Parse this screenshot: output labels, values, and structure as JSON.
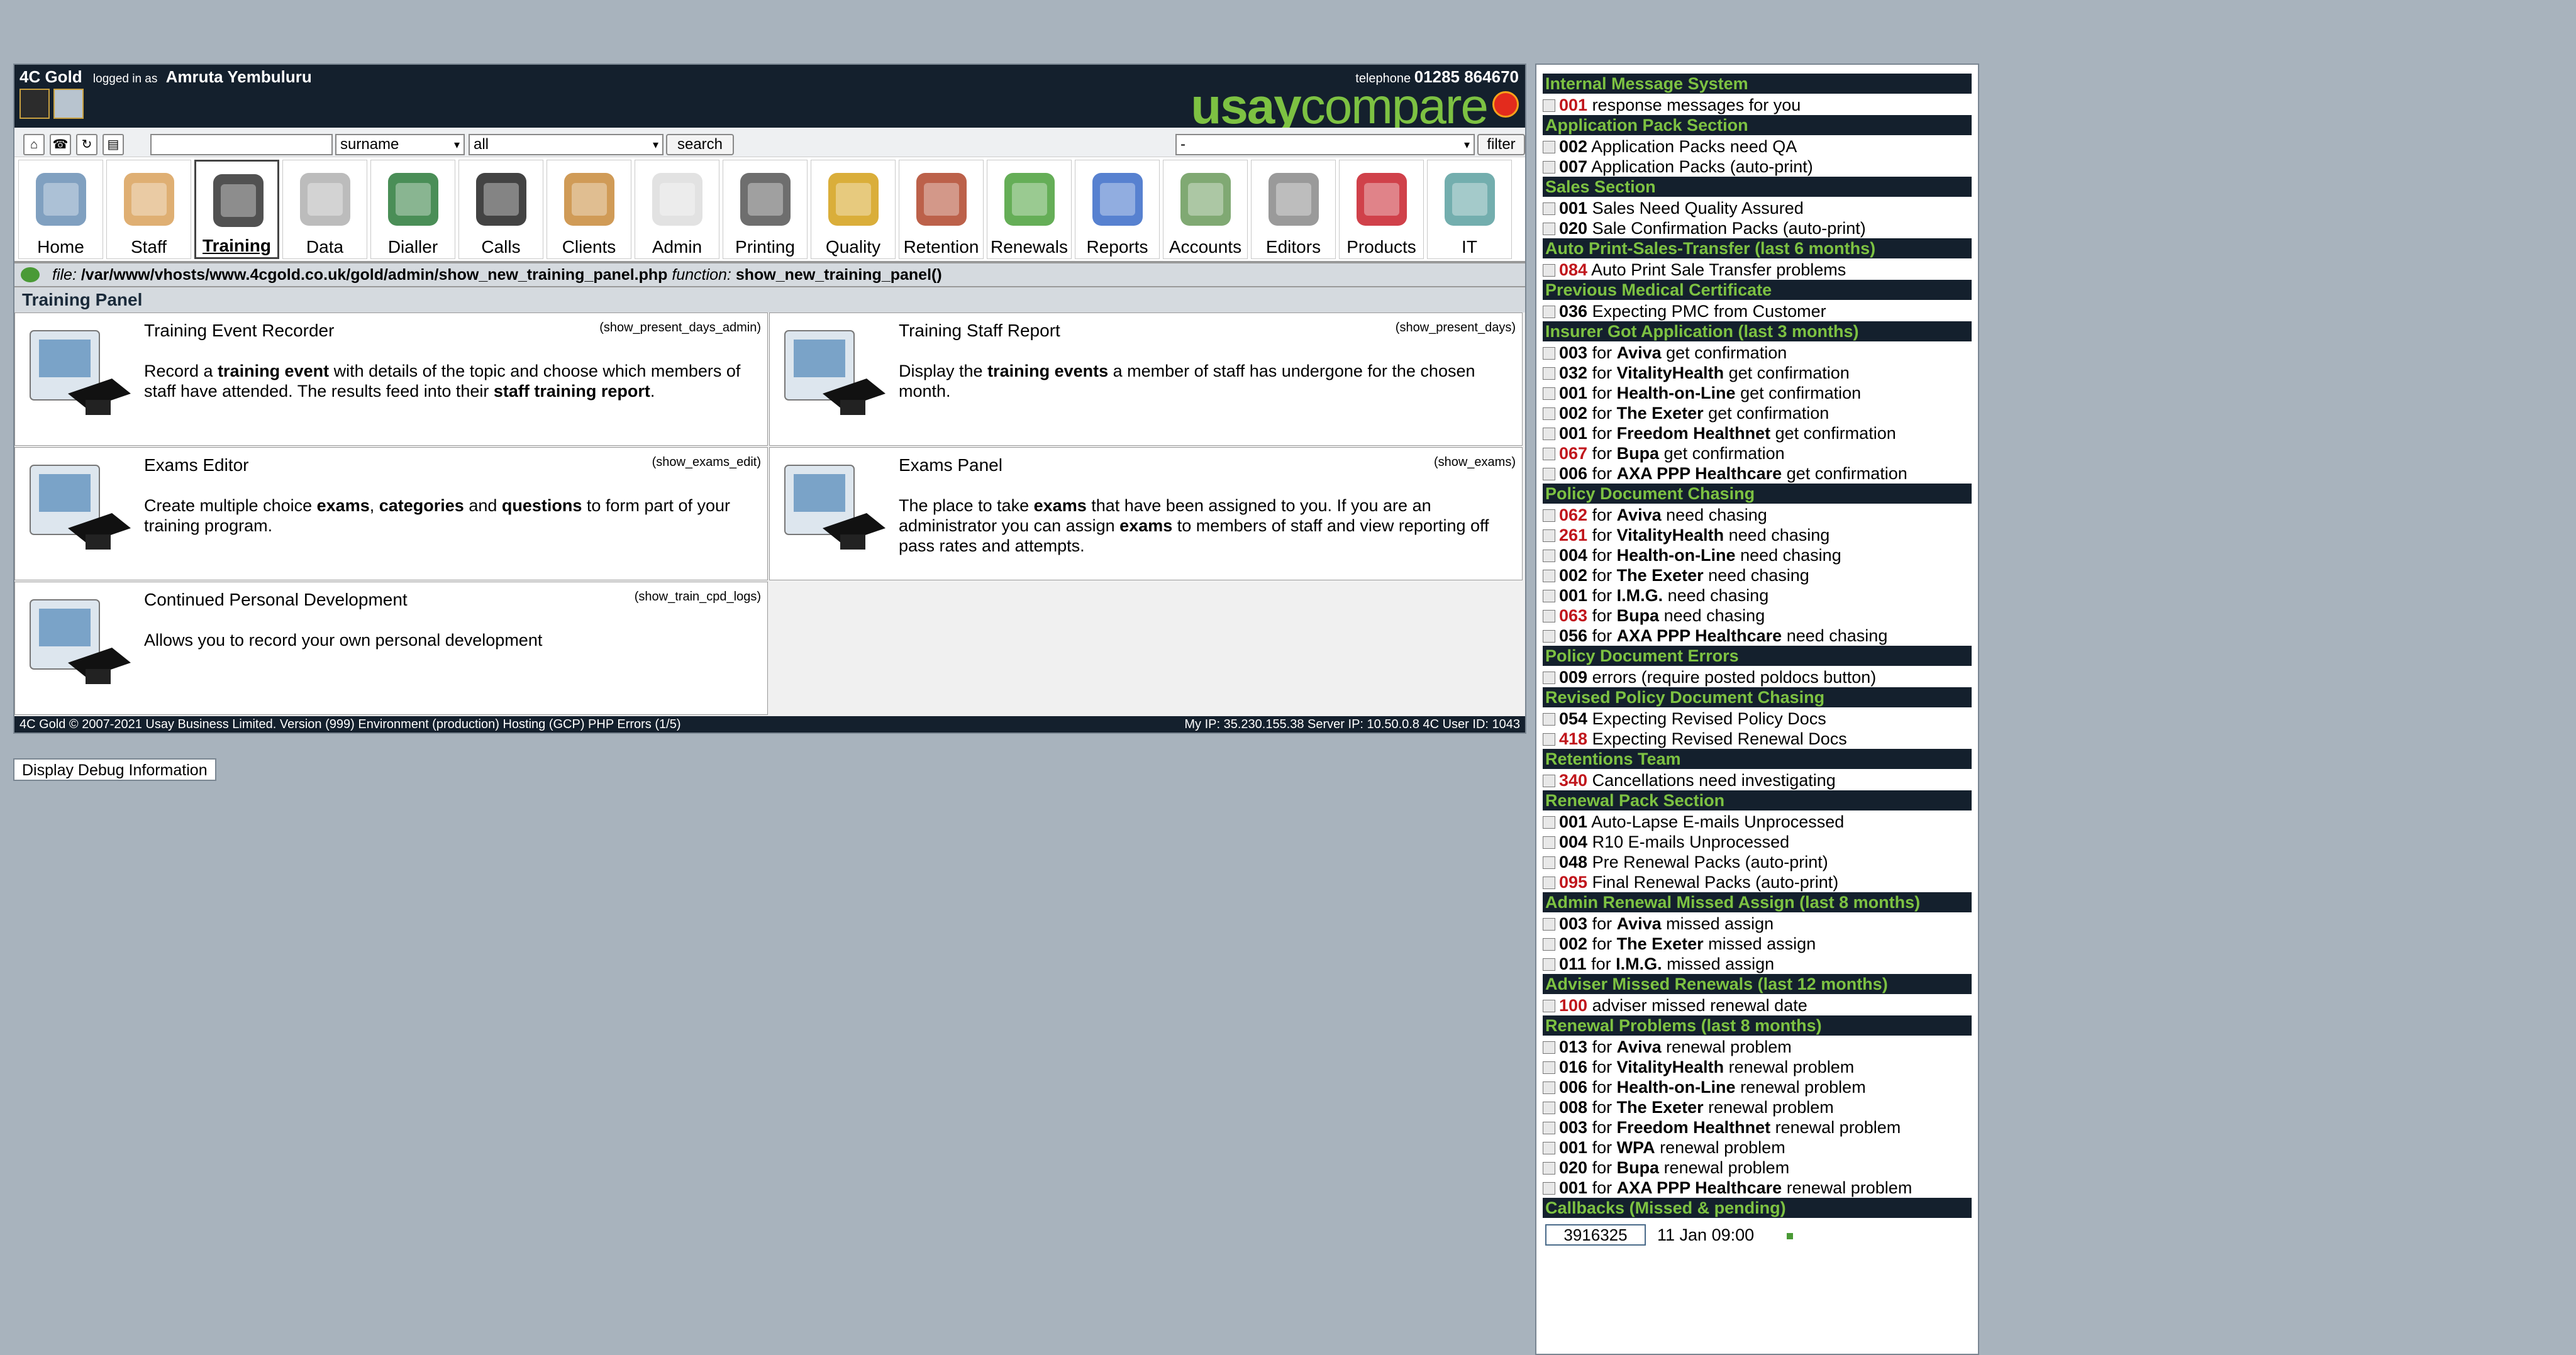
{
  "header": {
    "app_name": "4C Gold",
    "logged_in_as": "logged in as",
    "user": "Amruta Yembuluru",
    "telephone_label": "telephone",
    "telephone": "01285 864670",
    "logo": {
      "u": "u",
      "say": "say",
      "compare": "compare"
    }
  },
  "search": {
    "field_select": "surname",
    "scope_select": "all",
    "search_label": "search",
    "filter_select": "-",
    "filter_label": "filter"
  },
  "nav": [
    {
      "label": "Home",
      "icon": "house-icon"
    },
    {
      "label": "Staff",
      "icon": "staff-icon"
    },
    {
      "label": "Training",
      "icon": "graduation-cap-icon",
      "active": true
    },
    {
      "label": "Data",
      "icon": "database-icon"
    },
    {
      "label": "Dialler",
      "icon": "rotary-dial-icon"
    },
    {
      "label": "Calls",
      "icon": "telephone-icon"
    },
    {
      "label": "Clients",
      "icon": "filing-cabinet-icon"
    },
    {
      "label": "Admin",
      "icon": "document-icon"
    },
    {
      "label": "Printing",
      "icon": "printer-icon"
    },
    {
      "label": "Quality",
      "icon": "thumbs-up-icon"
    },
    {
      "label": "Retention",
      "icon": "alert-chest-icon"
    },
    {
      "label": "Renewals",
      "icon": "recycle-icon"
    },
    {
      "label": "Reports",
      "icon": "bar-chart-icon"
    },
    {
      "label": "Accounts",
      "icon": "money-icon"
    },
    {
      "label": "Editors",
      "icon": "gears-icon"
    },
    {
      "label": "Products",
      "icon": "target-icon"
    },
    {
      "label": "IT",
      "icon": "tools-icon"
    }
  ],
  "filebar": {
    "file_label": "file:",
    "file_path": "/var/www/vhosts/www.4cgold.co.uk/gold/admin/show_new_training_panel.php",
    "function_label": "function:",
    "function_name": "show_new_training_panel()"
  },
  "panel_title": "Training Panel",
  "cards": [
    {
      "title": "Training Event Recorder",
      "func": "(show_present_days_admin)",
      "desc": "Record a <b>training event</b> with details of the topic and choose which members of staff have attended. The results feed into their <b>staff training report</b>."
    },
    {
      "title": "Training Staff Report",
      "func": "(show_present_days)",
      "desc": "Display the <b>training events</b> a member of staff has undergone for the chosen month."
    },
    {
      "title": "Exams Editor",
      "func": "(show_exams_edit)",
      "desc": "Create multiple choice <b>exams</b>, <b>categories</b> and <b>questions</b> to form part of your training program."
    },
    {
      "title": "Exams Panel",
      "func": "(show_exams)",
      "desc": "The place to take <b>exams</b> that have been assigned to you. If you are an administrator you can assign <b>exams</b> to members of staff and view reporting off pass rates and attempts."
    },
    {
      "title": "Continued Personal Development",
      "func": "(show_train_cpd_logs)",
      "desc": "Allows you to record your own personal development"
    }
  ],
  "footer": {
    "left": "4C Gold © 2007-2021 Usay Business Limited. Version (999) Environment (production) Hosting (GCP) PHP Errors (1/5)",
    "right": "My IP: 35.230.155.38 Server IP: 10.50.0.8 4C User ID: 1043"
  },
  "debug_button": "Display Debug Information",
  "sidebar": [
    {
      "heading": "Internal Message System",
      "items": [
        {
          "num": "001",
          "red": true,
          "text": " response messages for you"
        }
      ]
    },
    {
      "heading": "Application Pack Section",
      "items": [
        {
          "num": "002",
          "text": " Application Packs need QA"
        },
        {
          "num": "007",
          "text": " Application Packs (auto-print)"
        }
      ]
    },
    {
      "heading": "Sales Section",
      "items": [
        {
          "num": "001",
          "text": " Sales Need Quality Assured"
        },
        {
          "num": "020",
          "text": " Sale Confirmation Packs (auto-print)"
        }
      ]
    },
    {
      "heading": "Auto Print-Sales-Transfer (last 6 months)",
      "items": [
        {
          "num": "084",
          "red": true,
          "text": " Auto Print Sale Transfer problems"
        }
      ]
    },
    {
      "heading": "Previous Medical Certificate",
      "items": [
        {
          "num": "036",
          "text": " Expecting PMC from Customer"
        }
      ]
    },
    {
      "heading": "Insurer Got Application (last 3 months)",
      "items": [
        {
          "num": "003",
          "pre": " for ",
          "ins": "Aviva",
          "text": " get confirmation"
        },
        {
          "num": "032",
          "pre": " for ",
          "ins": "VitalityHealth",
          "text": " get confirmation"
        },
        {
          "num": "001",
          "pre": " for ",
          "ins": "Health-on-Line",
          "text": " get confirmation"
        },
        {
          "num": "002",
          "pre": " for ",
          "ins": "The Exeter",
          "text": " get confirmation"
        },
        {
          "num": "001",
          "pre": " for ",
          "ins": "Freedom Healthnet",
          "text": " get confirmation"
        },
        {
          "num": "067",
          "red": true,
          "pre": " for ",
          "ins": "Bupa",
          "text": " get confirmation"
        },
        {
          "num": "006",
          "pre": " for ",
          "ins": "AXA PPP Healthcare",
          "text": " get confirmation"
        }
      ]
    },
    {
      "heading": "Policy Document Chasing",
      "items": [
        {
          "num": "062",
          "red": true,
          "pre": " for ",
          "ins": "Aviva",
          "text": " need chasing"
        },
        {
          "num": "261",
          "red": true,
          "pre": " for ",
          "ins": "VitalityHealth",
          "text": " need chasing"
        },
        {
          "num": "004",
          "pre": " for ",
          "ins": "Health-on-Line",
          "text": " need chasing"
        },
        {
          "num": "002",
          "pre": " for ",
          "ins": "The Exeter",
          "text": " need chasing"
        },
        {
          "num": "001",
          "pre": " for ",
          "ins": "I.M.G.",
          "text": " need chasing"
        },
        {
          "num": "063",
          "red": true,
          "pre": " for ",
          "ins": "Bupa",
          "text": " need chasing"
        },
        {
          "num": "056",
          "pre": " for ",
          "ins": "AXA PPP Healthcare",
          "text": " need chasing"
        }
      ]
    },
    {
      "heading": "Policy Document Errors",
      "items": [
        {
          "num": "009",
          "text": " errors (require posted poldocs button)"
        }
      ]
    },
    {
      "heading": "Revised Policy Document Chasing",
      "items": [
        {
          "num": "054",
          "text": " Expecting Revised Policy Docs"
        },
        {
          "num": "418",
          "red": true,
          "text": " Expecting Revised Renewal Docs"
        }
      ]
    },
    {
      "heading": "Retentions Team",
      "items": [
        {
          "num": "340",
          "red": true,
          "text": " Cancellations need investigating"
        }
      ]
    },
    {
      "heading": "Renewal Pack Section",
      "items": [
        {
          "num": "001",
          "text": " Auto-Lapse E-mails Unprocessed"
        },
        {
          "num": "004",
          "text": " R10 E-mails Unprocessed"
        },
        {
          "num": "048",
          "text": " Pre Renewal Packs (auto-print)"
        },
        {
          "num": "095",
          "red": true,
          "text": " Final Renewal Packs (auto-print)"
        }
      ]
    },
    {
      "heading": "Admin Renewal Missed Assign (last 8 months)",
      "items": [
        {
          "num": "003",
          "pre": " for ",
          "ins": "Aviva",
          "text": " missed assign"
        },
        {
          "num": "002",
          "pre": " for ",
          "ins": "The Exeter",
          "text": " missed assign"
        },
        {
          "num": "011",
          "pre": " for ",
          "ins": "I.M.G.",
          "text": " missed assign"
        }
      ]
    },
    {
      "heading": "Adviser Missed Renewals (last 12 months)",
      "items": [
        {
          "num": "100",
          "red": true,
          "text": " adviser missed renewal date"
        }
      ]
    },
    {
      "heading": "Renewal Problems (last 8 months)",
      "items": [
        {
          "num": "013",
          "pre": " for ",
          "ins": "Aviva",
          "text": " renewal problem"
        },
        {
          "num": "016",
          "pre": " for ",
          "ins": "VitalityHealth",
          "text": " renewal problem"
        },
        {
          "num": "006",
          "pre": " for ",
          "ins": "Health-on-Line",
          "text": " renewal problem"
        },
        {
          "num": "008",
          "pre": " for ",
          "ins": "The Exeter",
          "text": " renewal problem"
        },
        {
          "num": "003",
          "pre": " for ",
          "ins": "Freedom Healthnet",
          "text": " renewal problem"
        },
        {
          "num": "001",
          "pre": " for ",
          "ins": "WPA",
          "text": " renewal problem"
        },
        {
          "num": "020",
          "pre": " for ",
          "ins": "Bupa",
          "text": " renewal problem"
        },
        {
          "num": "001",
          "pre": " for ",
          "ins": "AXA PPP Healthcare",
          "text": " renewal problem"
        }
      ]
    },
    {
      "heading": "Callbacks (Missed & pending)",
      "items": []
    }
  ],
  "callback": {
    "id": "3916325",
    "date": "11 Jan 09:00"
  }
}
